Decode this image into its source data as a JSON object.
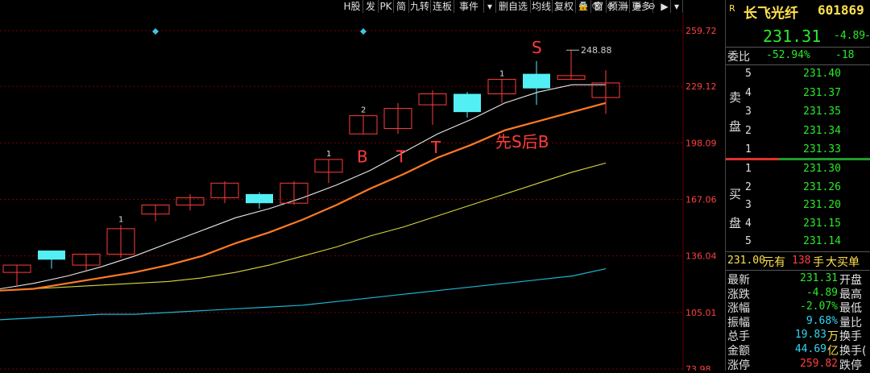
{
  "toolbar": {
    "buttons": [
      "H股",
      "发",
      "PK",
      "简",
      "九转",
      "连板",
      "事件",
      "▾",
      "删自选",
      "均线",
      "复权",
      "叠",
      "窗",
      "预测",
      "更多"
    ],
    "icons": [
      "lock-icon",
      "eye-icon",
      "eye-slash-icon",
      "print-icon",
      "zoom-in-icon",
      "zoom-out-icon"
    ],
    "nav": [
      "▶",
      "▾"
    ]
  },
  "chart_data": {
    "type": "candlestick",
    "y_ticks": [
      "259.72",
      "229.12",
      "198.09",
      "167.06",
      "136.04",
      "105.01",
      "73.98"
    ],
    "ylim": [
      73.98,
      259.72
    ],
    "candles": [
      {
        "open": 127,
        "high": 131,
        "low": 120,
        "close": 131,
        "color": "red"
      },
      {
        "open": 139,
        "high": 139,
        "low": 129,
        "close": 134,
        "color": "cyan"
      },
      {
        "open": 131,
        "high": 137,
        "low": 128,
        "close": 137,
        "color": "red"
      },
      {
        "open": 137,
        "high": 153,
        "low": 135,
        "close": 151,
        "color": "red"
      },
      {
        "open": 159,
        "high": 164,
        "low": 155,
        "close": 164,
        "color": "red"
      },
      {
        "open": 164,
        "high": 170,
        "low": 161,
        "close": 168,
        "color": "red"
      },
      {
        "open": 168,
        "high": 177,
        "low": 165,
        "close": 176,
        "color": "red"
      },
      {
        "open": 170,
        "high": 171,
        "low": 162,
        "close": 165,
        "color": "cyan"
      },
      {
        "open": 165,
        "high": 177,
        "low": 164,
        "close": 176,
        "color": "red"
      },
      {
        "open": 182,
        "high": 189,
        "low": 176,
        "close": 189,
        "color": "red"
      },
      {
        "open": 203,
        "high": 213,
        "low": 203,
        "close": 213,
        "color": "red"
      },
      {
        "open": 206,
        "high": 220,
        "low": 203,
        "close": 217,
        "color": "red"
      },
      {
        "open": 219,
        "high": 227,
        "low": 208,
        "close": 225,
        "color": "red"
      },
      {
        "open": 225,
        "high": 226,
        "low": 212,
        "close": 215,
        "color": "cyan"
      },
      {
        "open": 225,
        "high": 233,
        "low": 220,
        "close": 233,
        "color": "red"
      },
      {
        "open": 236,
        "high": 243,
        "low": 219,
        "close": 228,
        "color": "cyan"
      },
      {
        "open": 233,
        "high": 249,
        "low": 233,
        "close": 235,
        "color": "red"
      },
      {
        "open": 223,
        "high": 238,
        "low": 214,
        "close": 231,
        "color": "red"
      }
    ],
    "ma_white": [
      118,
      121,
      125,
      130,
      136,
      143,
      150,
      157,
      162,
      168,
      175,
      183,
      193,
      203,
      211,
      220,
      226,
      230,
      230
    ],
    "ma_orange": [
      117,
      118,
      121,
      124,
      127,
      131,
      136,
      143,
      149,
      156,
      164,
      173,
      181,
      190,
      197,
      205,
      210,
      215,
      220
    ],
    "ma_yellow": [
      117,
      118,
      119,
      120,
      121,
      122,
      124,
      127,
      131,
      136,
      141,
      147,
      152,
      158,
      164,
      170,
      176,
      182,
      187
    ],
    "ma_cyan": [
      101,
      102,
      103,
      104,
      104,
      105,
      106,
      107,
      108,
      109,
      111,
      113,
      115,
      117,
      119,
      121,
      123,
      125,
      129
    ],
    "annotations": [
      {
        "text": "1",
        "candle": 3
      },
      {
        "text": "1",
        "candle": 9
      },
      {
        "text": "2",
        "candle": 10
      },
      {
        "text": "1",
        "candle": 14
      },
      {
        "text": "248.88",
        "candle": 16
      }
    ],
    "signals": [
      {
        "text": "B",
        "candle": 10
      },
      {
        "text": "T",
        "candle": 11
      },
      {
        "text": "T",
        "candle": 12
      },
      {
        "text": "先S后B",
        "candle": 14
      },
      {
        "text": "S",
        "candle": 15
      }
    ],
    "markers": [
      4,
      10
    ]
  },
  "panel": {
    "r_label": "R",
    "stock_name": "长飞光纤",
    "stock_code": "601869",
    "price": "231.31",
    "change": "-4.89",
    "change_pct": "-2",
    "weibi_label": "委比",
    "weibi_pct": "-52.94%",
    "weibi_val": "-18",
    "sell_label": [
      "卖",
      "盘"
    ],
    "buy_label": [
      "买",
      "盘"
    ],
    "sell_orders": [
      {
        "level": "5",
        "price": "231.40"
      },
      {
        "level": "4",
        "price": "231.37"
      },
      {
        "level": "3",
        "price": "231.35"
      },
      {
        "level": "2",
        "price": "231.34"
      },
      {
        "level": "1",
        "price": "231.33"
      }
    ],
    "buy_orders": [
      {
        "level": "1",
        "price": "231.30"
      },
      {
        "level": "2",
        "price": "231.26"
      },
      {
        "level": "3",
        "price": "231.20"
      },
      {
        "level": "4",
        "price": "231.15"
      },
      {
        "level": "5",
        "price": "231.14"
      }
    ],
    "big_order": {
      "price": "231.00",
      "unit": "元有",
      "qty": "138",
      "qty_unit": "手",
      "label": "大买单"
    },
    "stats": [
      {
        "label": "最新",
        "value": "231.31",
        "cls": "green",
        "suffix": "",
        "label2": "开盘"
      },
      {
        "label": "涨跌",
        "value": "-4.89",
        "cls": "green",
        "suffix": "",
        "label2": "最高"
      },
      {
        "label": "涨幅",
        "value": "-2.07%",
        "cls": "green",
        "suffix": "",
        "label2": "最低"
      },
      {
        "label": "振幅",
        "value": "9.68%",
        "cls": "cyan",
        "suffix": "",
        "label2": "量比"
      },
      {
        "label": "总手",
        "value": "19.83",
        "cls": "cyan",
        "suffix": "万",
        "label2": "换手"
      },
      {
        "label": "金额",
        "value": "44.69",
        "cls": "cyan",
        "suffix": "亿",
        "label2": "换手("
      },
      {
        "label": "涨停",
        "value": "259.82",
        "cls": "red",
        "suffix": "",
        "label2": "跌停"
      }
    ]
  }
}
